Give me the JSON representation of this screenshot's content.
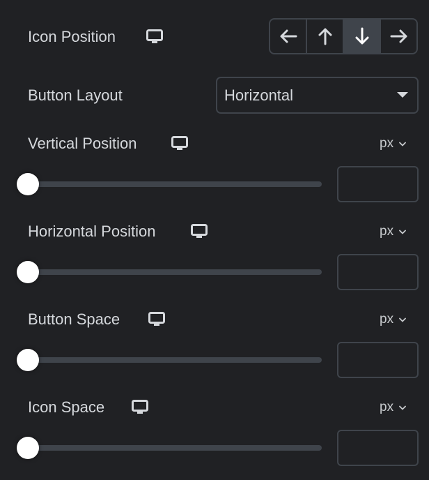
{
  "icon_position": {
    "label": "Icon Position",
    "responsive_icon": "monitor-icon",
    "options": [
      {
        "name": "left",
        "icon": "arrow-left-icon",
        "glyph": "←",
        "active": false
      },
      {
        "name": "top",
        "icon": "arrow-up-icon",
        "glyph": "↑",
        "active": false
      },
      {
        "name": "bottom",
        "icon": "arrow-down-icon",
        "glyph": "↓",
        "active": true
      },
      {
        "name": "right",
        "icon": "arrow-right-icon",
        "glyph": "→",
        "active": false
      }
    ],
    "selected": "bottom"
  },
  "button_layout": {
    "label": "Button Layout",
    "value": "Horizontal"
  },
  "controls": [
    {
      "label": "Vertical Position",
      "unit": "px",
      "slider_value": 0,
      "input_value": ""
    },
    {
      "label": "Horizontal Position",
      "unit": "px",
      "slider_value": 0,
      "input_value": ""
    },
    {
      "label": "Button Space",
      "unit": "px",
      "slider_value": 0,
      "input_value": ""
    },
    {
      "label": "Icon Space",
      "unit": "px",
      "slider_value": 0,
      "input_value": ""
    }
  ],
  "colors": {
    "background": "#202124",
    "text": "#d5d8dc",
    "border": "#3f444b",
    "active_segment": "#3f444b",
    "thumb": "#ffffff"
  }
}
